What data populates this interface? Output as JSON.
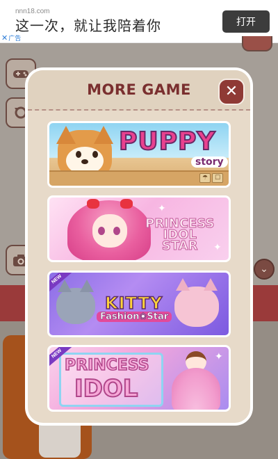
{
  "ad": {
    "domain": "nnn18.com",
    "title": "这一次，就让我陪着你",
    "open_button": "打开",
    "ad_label": "广告",
    "close_glyph": "✕"
  },
  "background": {
    "side_icons": [
      "gamepad-icon",
      "refresh-icon",
      "camera-icon"
    ],
    "chevron_glyph": "⌄"
  },
  "modal": {
    "title": "MORE GAME",
    "close_glyph": "✕",
    "games": [
      {
        "title": "PUPPY",
        "subtitle": "story",
        "badges": [
          "☂",
          "☐"
        ]
      },
      {
        "title_line1": "PRINCESS",
        "title_line2": "IDOL",
        "title_line3": "STAR"
      },
      {
        "tag": "NEW",
        "title": "KITTY",
        "subtitle": "Fashion❀Star"
      },
      {
        "tag": "NEW",
        "title_line1": "PRINCESS",
        "title_line2": "IDOL"
      }
    ]
  },
  "colors": {
    "modal_title": "#7a2f2f",
    "close_button": "#8f3a35",
    "modal_bg": "#e7dac9"
  }
}
